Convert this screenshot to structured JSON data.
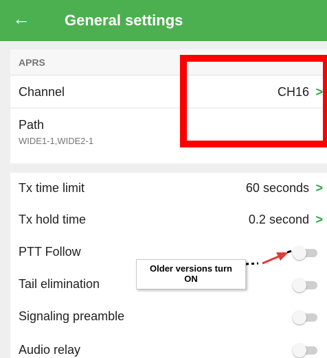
{
  "header": {
    "back_icon": "arrow-left-icon",
    "title": "General settings",
    "color": "#4caf50"
  },
  "aprs_section": {
    "header": "APRS",
    "channel": {
      "label": "Channel",
      "value": "CH16"
    },
    "path": {
      "label": "Path",
      "value": "WIDE1-1,WIDE2-1"
    }
  },
  "settings": {
    "tx_time_limit": {
      "label": "Tx time limit",
      "value": "60 seconds"
    },
    "tx_hold_time": {
      "label": "Tx hold time",
      "value": "0.2 second"
    },
    "ptt_follow": {
      "label": "PTT Follow",
      "enabled": false
    },
    "tail_elimination": {
      "label": "Tail elimination",
      "enabled": false
    },
    "signaling_preamble": {
      "label": "Signaling preamble",
      "enabled": false
    },
    "audio_relay": {
      "label": "Audio relay",
      "enabled": false
    }
  },
  "chevron": ">",
  "annotation": {
    "line1": "Older versions turn",
    "line2": "ON",
    "highlight_color": "#ff0000"
  }
}
